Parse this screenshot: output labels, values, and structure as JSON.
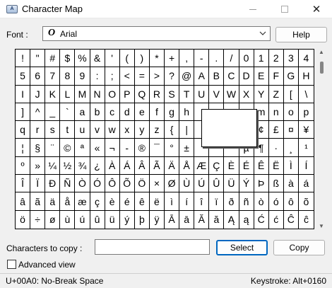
{
  "window": {
    "title": "Character Map",
    "icon_text": "A",
    "close_glyph": "✕"
  },
  "font": {
    "label": "Font :",
    "selected": "Arial",
    "glyph": "O"
  },
  "buttons": {
    "help": "Help",
    "select": "Select",
    "copy": "Copy"
  },
  "grid": {
    "rows": [
      [
        "!",
        "\"",
        "#",
        "$",
        "%",
        "&",
        "'",
        "(",
        ")",
        "*",
        "+",
        ",",
        "-",
        ".",
        "/",
        "0",
        "1",
        "2",
        "3",
        "4"
      ],
      [
        "5",
        "6",
        "7",
        "8",
        "9",
        ":",
        ";",
        "<",
        "=",
        ">",
        "?",
        "@",
        "A",
        "B",
        "C",
        "D",
        "E",
        "F",
        "G",
        "H"
      ],
      [
        "I",
        "J",
        "K",
        "L",
        "M",
        "N",
        "O",
        "P",
        "Q",
        "R",
        "S",
        "T",
        "U",
        "V",
        "W",
        "X",
        "Y",
        "Z",
        "[",
        "\\"
      ],
      [
        "]",
        "^",
        "_",
        "`",
        "a",
        "b",
        "c",
        "d",
        "e",
        "f",
        "g",
        "h",
        "",
        "",
        "",
        "",
        "m",
        "n",
        "o",
        "p"
      ],
      [
        "q",
        "r",
        "s",
        "t",
        "u",
        "v",
        "w",
        "x",
        "y",
        "z",
        "{",
        "|",
        "",
        "",
        "",
        "",
        "¢",
        "£",
        "¤",
        "¥"
      ],
      [
        "¦",
        "§",
        "¨",
        "©",
        "ª",
        "«",
        "¬",
        "-",
        "®",
        "¯",
        "°",
        "±",
        "",
        "",
        "",
        "µ",
        "¶",
        "·",
        "¸",
        "¹"
      ],
      [
        "º",
        "»",
        "¼",
        "½",
        "¾",
        "¿",
        "À",
        "Á",
        "Â",
        "Ã",
        "Ä",
        "Å",
        "Æ",
        "Ç",
        "È",
        "É",
        "Ê",
        "Ë",
        "Ì",
        "Í"
      ],
      [
        "Î",
        "Ï",
        "Ð",
        "Ñ",
        "Ò",
        "Ó",
        "Ô",
        "Õ",
        "Ö",
        "×",
        "Ø",
        "Ù",
        "Ú",
        "Û",
        "Ü",
        "Ý",
        "Þ",
        "ß",
        "à",
        "á"
      ],
      [
        "â",
        "ã",
        "ä",
        "å",
        "æ",
        "ç",
        "è",
        "é",
        "ê",
        "ë",
        "ì",
        "í",
        "î",
        "ï",
        "ð",
        "ñ",
        "ò",
        "ó",
        "ô",
        "õ"
      ],
      [
        "ö",
        "÷",
        "ø",
        "ù",
        "ú",
        "û",
        "ü",
        "ý",
        "þ",
        "ÿ",
        "Ā",
        "ā",
        "Ă",
        "ă",
        "Ą",
        "ą",
        "Ć",
        "ć",
        "Ĉ",
        "ĉ"
      ]
    ],
    "zoom_char": ""
  },
  "copy": {
    "label": "Characters to copy :",
    "value": ""
  },
  "advanced": {
    "label": "Advanced view",
    "checked": false
  },
  "status": {
    "char_info": "U+00A0: No-Break Space",
    "keystroke": "Keystroke: Alt+0160"
  },
  "colors": {
    "accent": "#0067c0",
    "background": "#f0f0f0"
  }
}
